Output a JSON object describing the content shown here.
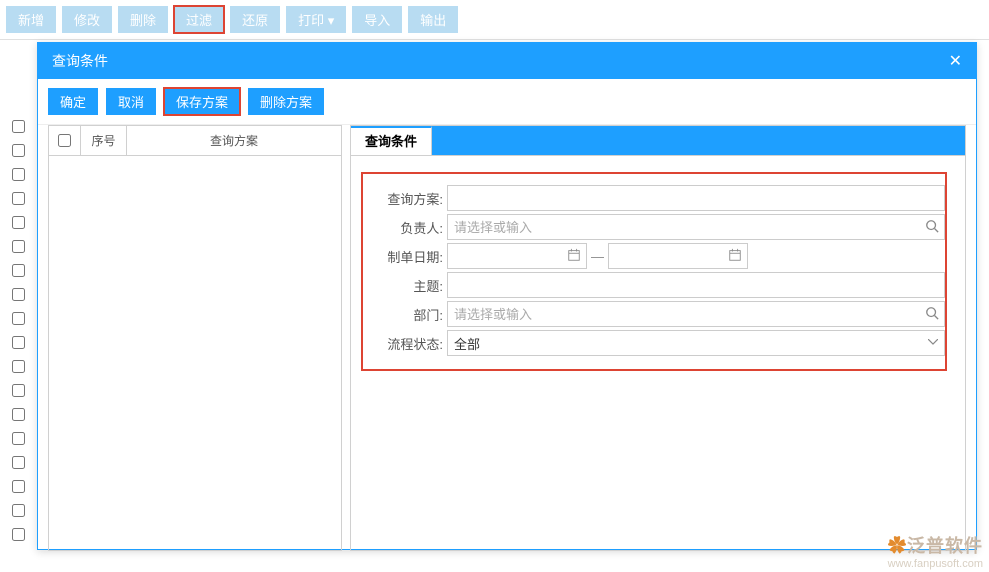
{
  "toolbar": {
    "buttons": [
      {
        "label": "新增",
        "hl": false
      },
      {
        "label": "修改",
        "hl": false
      },
      {
        "label": "删除",
        "hl": false
      },
      {
        "label": "过滤",
        "hl": true
      },
      {
        "label": "还原",
        "hl": false
      },
      {
        "label": "打印",
        "hl": false
      },
      {
        "label": "导入",
        "hl": false
      },
      {
        "label": "输出",
        "hl": false
      }
    ],
    "print_caret": "▾"
  },
  "bg_rows": 18,
  "dialog": {
    "title": "查询条件",
    "buttons": [
      {
        "label": "确定",
        "hl": false
      },
      {
        "label": "取消",
        "hl": false
      },
      {
        "label": "保存方案",
        "hl": true
      },
      {
        "label": "删除方案",
        "hl": false
      }
    ],
    "left": {
      "col1": "序号",
      "col2": "查询方案"
    },
    "tab": "查询条件",
    "form": {
      "scheme_label": "查询方案:",
      "scheme_value": "",
      "owner_label": "负责人:",
      "owner_placeholder": "请选择或输入",
      "date_label": "制单日期:",
      "date_from": "",
      "date_to": "",
      "subject_label": "主题:",
      "subject_value": "",
      "dept_label": "部门:",
      "dept_placeholder": "请选择或输入",
      "status_label": "流程状态:",
      "status_value": "全部"
    }
  },
  "watermark": {
    "brand": "泛普软件",
    "url": "www.fanpusoft.com"
  }
}
